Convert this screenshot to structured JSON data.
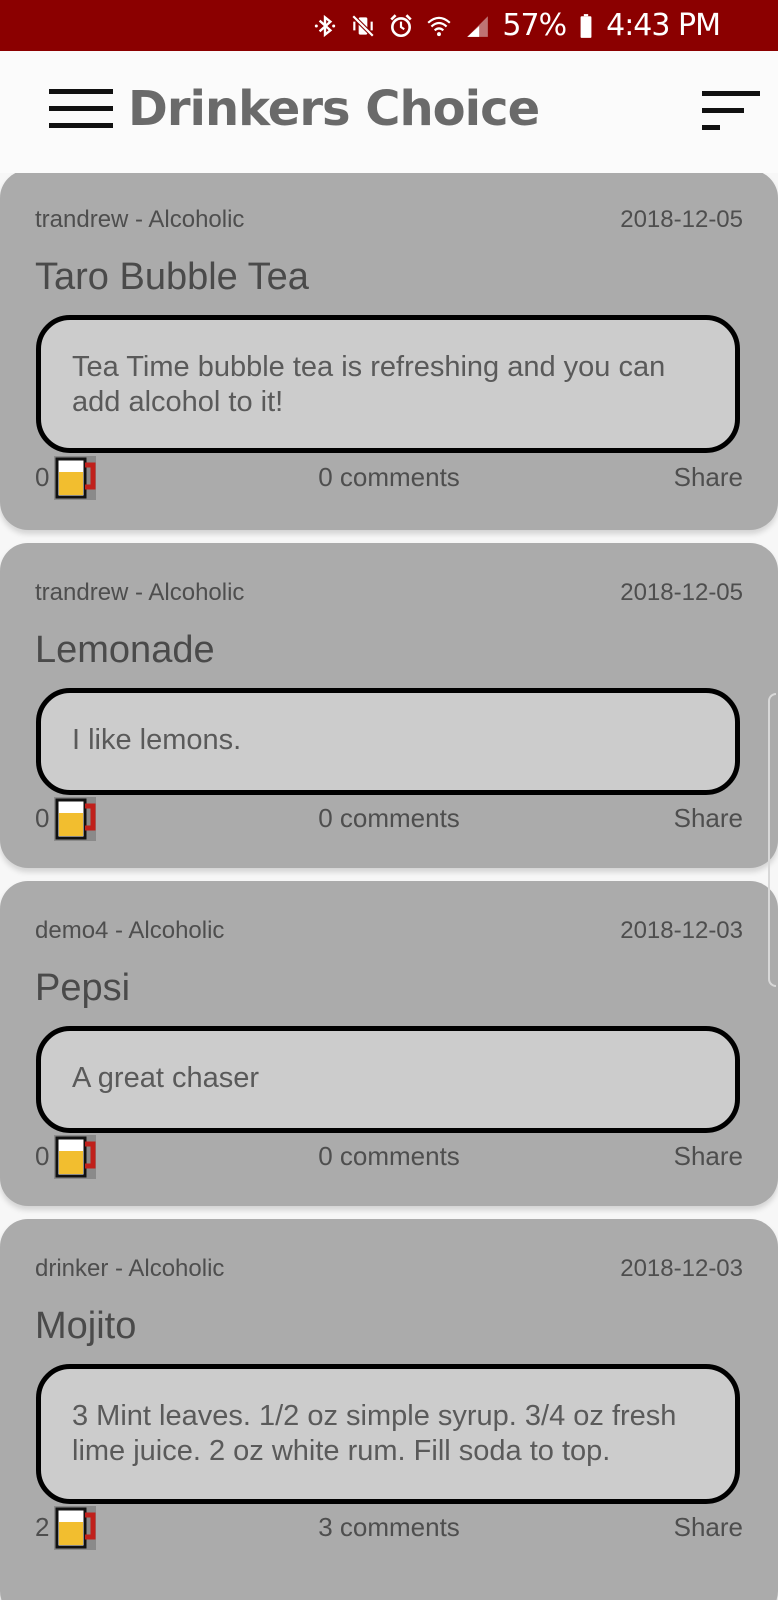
{
  "status_bar": {
    "battery": "57%",
    "time": "4:43 PM",
    "icons": [
      "bluetooth-icon",
      "vibrate-mute-icon",
      "alarm-icon",
      "wifi-icon",
      "signal-icon",
      "battery-icon"
    ]
  },
  "header": {
    "title": "Drinkers Choice",
    "menu_icon": "hamburger-menu-icon",
    "sort_icon": "sort-icon"
  },
  "colors": {
    "status_bar": "#8b0000",
    "card_bg": "#ababab",
    "body_bg": "#cccccc",
    "mug_beer": "#f2be2f",
    "mug_handle": "#c0201b"
  },
  "posts": [
    {
      "meta": "trandrew - Alcoholic",
      "date": "2018-12-05",
      "title": "Taro Bubble Tea",
      "body": "Tea Time bubble tea is refreshing and you can add alcohol to it!",
      "likes": "0",
      "comments": "0 comments",
      "share": "Share"
    },
    {
      "meta": "trandrew - Alcoholic",
      "date": "2018-12-05",
      "title": "Lemonade",
      "body": "I like lemons.",
      "likes": "0",
      "comments": "0 comments",
      "share": "Share"
    },
    {
      "meta": "demo4 - Alcoholic",
      "date": "2018-12-03",
      "title": "Pepsi",
      "body": "A great chaser",
      "likes": "0",
      "comments": "0 comments",
      "share": "Share"
    },
    {
      "meta": "drinker - Alcoholic",
      "date": "2018-12-03",
      "title": "Mojito",
      "body": "3 Mint leaves. 1/2 oz simple syrup. 3/4 oz fresh lime juice. 2 oz white rum. Fill soda to top.",
      "likes": "2",
      "comments": "3 comments",
      "share": "Share"
    }
  ]
}
